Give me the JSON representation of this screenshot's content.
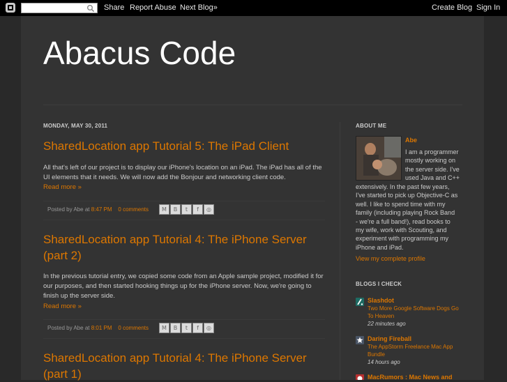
{
  "navbar": {
    "search_placeholder": "",
    "share": "Share",
    "report_abuse": "Report Abuse",
    "next_blog": "Next Blog»",
    "create_blog": "Create Blog",
    "sign_in": "Sign In"
  },
  "blog": {
    "title": "Abacus Code"
  },
  "posts": [
    {
      "date": "MONDAY, MAY 30, 2011",
      "title": "SharedLocation app Tutorial 5: The iPad Client",
      "body": "All that's left of our project is to display our iPhone's location on an iPad. The iPad has all of the UI elements that it needs. We will now add the Bonjour and networking client code.",
      "read_more": "Read more »",
      "posted_by": "Posted by Abe at",
      "time": "8:47 PM",
      "comments": "0 comments"
    },
    {
      "title": "SharedLocation app Tutorial 4: The iPhone Server (part 2)",
      "body": "In the previous tutorial entry, we copied some code from an Apple sample project, modified it for our purposes, and then started hooking things up for the iPhone server. Now, we're going to finish up the server side.",
      "read_more": "Read more »",
      "posted_by": "Posted by Abe at",
      "time": "8:01 PM",
      "comments": "0 comments"
    },
    {
      "title": "SharedLocation app Tutorial 4: The iPhone Server (part 1)"
    }
  ],
  "share_icons": [
    "email-icon",
    "blogthis-icon",
    "twitter-icon",
    "facebook-icon",
    "buzz-icon"
  ],
  "sidebar": {
    "about": {
      "header": "ABOUT ME",
      "name": "Abe",
      "lines_right": [
        "I am a programmer",
        "mostly working on",
        "the server side. I've",
        "used Java and C++"
      ],
      "lines_full": [
        "extensively. In the past few years,",
        "I've started to pick up Objective-C as",
        "well. I like to spend time with my",
        "family (including playing Rock Band",
        "- we're a full band!), read books to",
        "my wife, work with Scouting, and",
        "experiment with programming my",
        "iPhone and iPad."
      ],
      "profile_link": "View my complete profile"
    },
    "blogs": {
      "header": "BLOGS I CHECK",
      "items": [
        {
          "name": "Slashdot",
          "post": "Two More Google Software Dogs Go To Heaven",
          "time": "22 minutes ago",
          "color": "#1e6b63"
        },
        {
          "name": "Daring Fireball",
          "post": "The AppStorm Freelance Mac App Bundle",
          "time": "14 hours ago",
          "color": "#4a5566"
        },
        {
          "name": "MacRumors : Mac News and",
          "color": "#b83030"
        }
      ]
    }
  }
}
